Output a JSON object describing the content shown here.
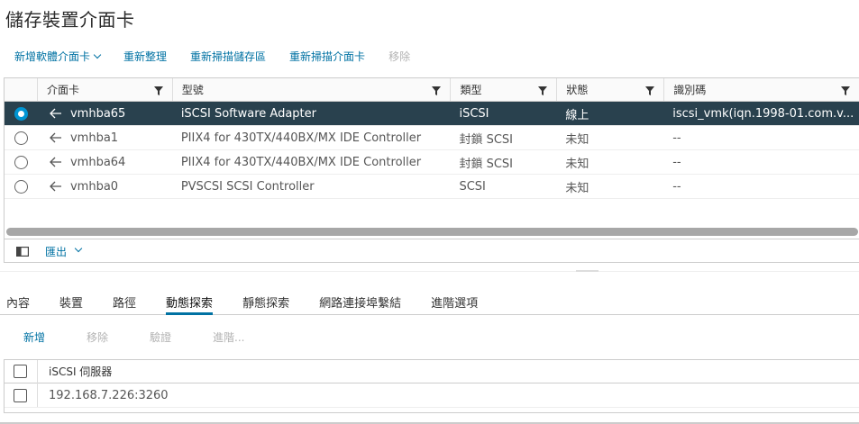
{
  "page": {
    "title": "儲存裝置介面卡"
  },
  "toolbar": {
    "add_software_adapter": "新增軟體介面卡",
    "refresh": "重新整理",
    "rescan_storage": "重新掃描儲存區",
    "rescan_adapter": "重新掃描介面卡",
    "remove": "移除"
  },
  "grid": {
    "columns": [
      "介面卡",
      "型號",
      "類型",
      "狀態",
      "識別碼"
    ],
    "rows": [
      {
        "adapter": "vmhba65",
        "model": "iSCSI Software Adapter",
        "type": "iSCSI",
        "status": "線上",
        "identifier": "iscsi_vmk(iqn.1998-01.com.v...",
        "selected": true
      },
      {
        "adapter": "vmhba1",
        "model": "PIIX4 for 430TX/440BX/MX IDE Controller",
        "type": "封鎖 SCSI",
        "status": "未知",
        "identifier": "--",
        "selected": false
      },
      {
        "adapter": "vmhba64",
        "model": "PIIX4 for 430TX/440BX/MX IDE Controller",
        "type": "封鎖 SCSI",
        "status": "未知",
        "identifier": "--",
        "selected": false
      },
      {
        "adapter": "vmhba0",
        "model": "PVSCSI SCSI Controller",
        "type": "SCSI",
        "status": "未知",
        "identifier": "--",
        "selected": false
      }
    ],
    "footer": {
      "export_label": "匯出"
    }
  },
  "tabs": [
    "內容",
    "裝置",
    "路徑",
    "動態探索",
    "靜態探索",
    "網路連接埠繫結",
    "進階選項"
  ],
  "active_tab": "動態探索",
  "sub_toolbar": {
    "add": "新增",
    "remove": "移除",
    "verify": "驗證",
    "advanced": "進階..."
  },
  "targets": {
    "header": "iSCSI 伺服器",
    "rows": [
      {
        "server": "192.168.7.226:3260"
      }
    ]
  },
  "colors": {
    "accent": "#0072a3",
    "selected_row": "#29414e",
    "radio_on": "#0095d3"
  },
  "icons": {
    "filter": "filter-icon",
    "adapter": "adapter-icon",
    "column_selector": "column-selector-icon"
  }
}
